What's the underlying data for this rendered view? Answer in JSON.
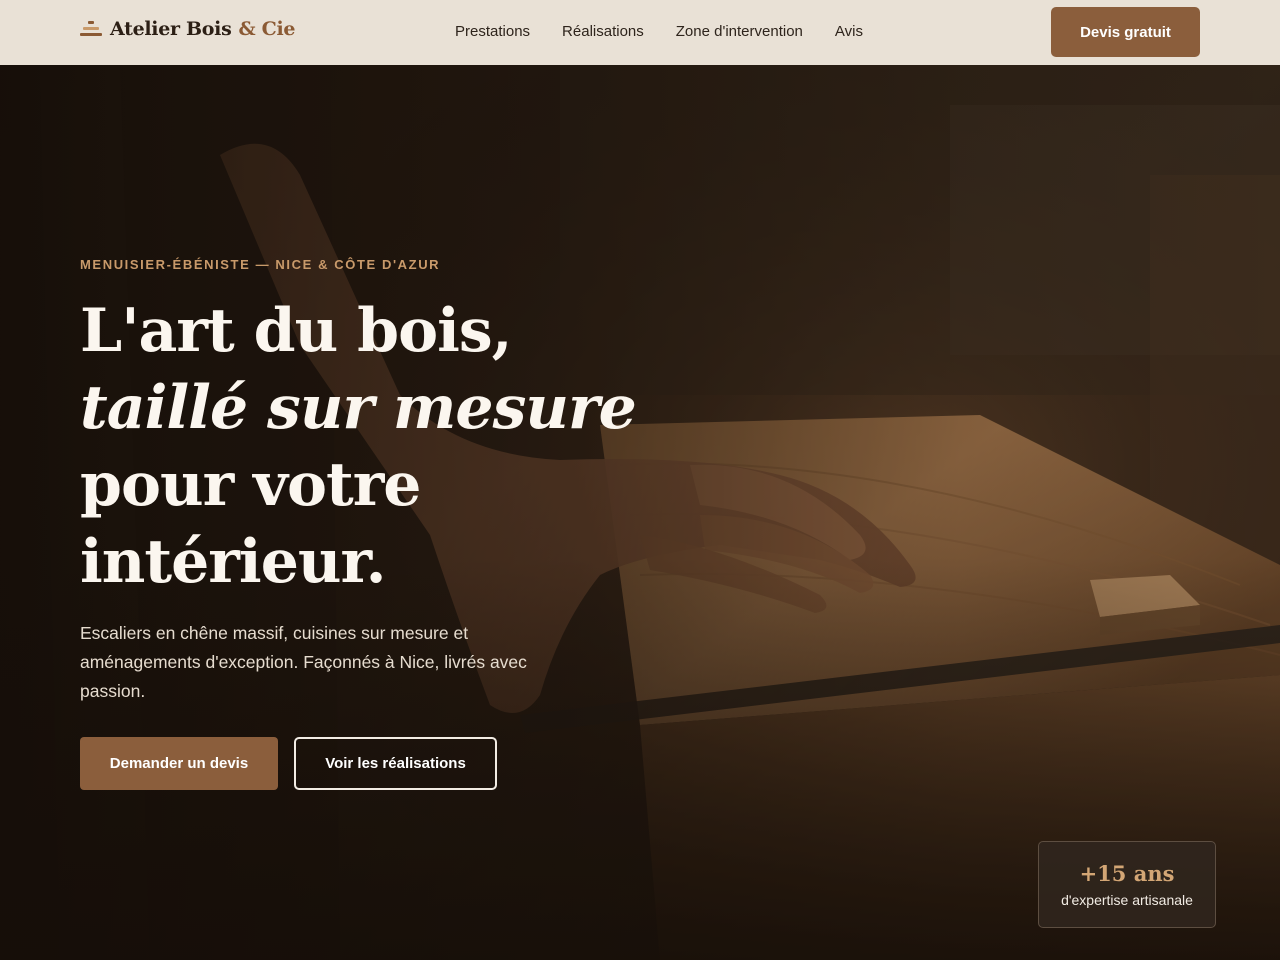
{
  "brand": {
    "name": "Atelier Bois",
    "accent": "& Cie",
    "icon": "workbench-logo-icon"
  },
  "nav": {
    "items": [
      {
        "label": "Prestations"
      },
      {
        "label": "Réalisations"
      },
      {
        "label": "Zone d'intervention"
      },
      {
        "label": "Avis"
      }
    ],
    "cta_label": "Devis gratuit"
  },
  "hero": {
    "eyebrow": "MENUISIER-ÉBÉNISTE — NICE & CÔTE D'AZUR",
    "headline": {
      "line1": "L'art du bois,",
      "line2": "taillé sur mesure",
      "line3": "pour votre",
      "line4": "intérieur."
    },
    "lead": "Escaliers en chêne massif, cuisines sur mesure et aménagements d'exception. Façonnés à Nice, livrés avec passion.",
    "primary_cta": "Demander un devis",
    "secondary_cta": "Voir les réalisations",
    "background_image": "hand-on-wooden-plank-photo"
  },
  "badge": {
    "value": "+15 ans",
    "label": "d'expertise artisanale"
  },
  "colors": {
    "header_bg": "#e9e1d6",
    "brand_dark": "#2c1f15",
    "brand_accent": "#8b5a34",
    "button_bg": "#8b5e3c",
    "eyebrow": "#c99a6a",
    "badge_value": "#d3a675"
  }
}
